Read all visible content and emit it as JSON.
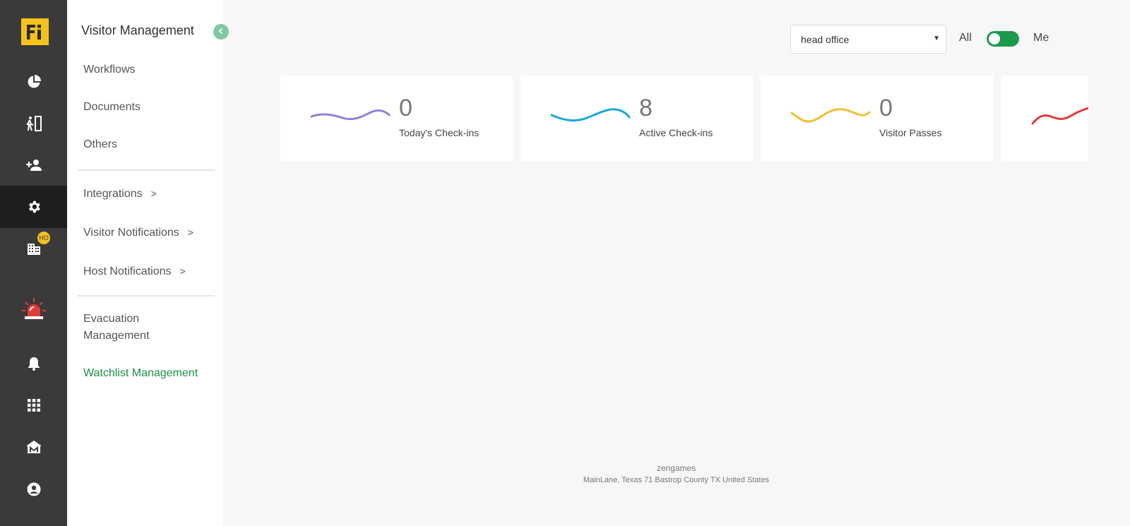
{
  "brand": {
    "logo_text": "Fi",
    "accent_color": "#f4c21c"
  },
  "rail": {
    "items": [
      {
        "icon": "dashboard-pie-icon"
      },
      {
        "icon": "exit-door-icon"
      },
      {
        "icon": "add-person-icon"
      },
      {
        "icon": "gear-icon",
        "active": true
      },
      {
        "icon": "building-icon",
        "badge": "HO"
      },
      {
        "icon": "emergency-siren-icon"
      },
      {
        "icon": "bell-icon"
      },
      {
        "icon": "apps-grid-icon"
      },
      {
        "icon": "marketplace-icon"
      },
      {
        "icon": "account-icon"
      }
    ]
  },
  "menu": {
    "title": "Visitor Management",
    "items": {
      "workflows": "Workflows",
      "documents": "Documents",
      "others": "Others",
      "integrations": "Integrations",
      "visitor_notifications": "Visitor Notifications",
      "host_notifications": "Host Notifications",
      "evacuation_line1": "Evacuation",
      "evacuation_line2": "Management",
      "watchlist": "Watchlist Management"
    },
    "chevron": ">"
  },
  "filters": {
    "location": "head office",
    "scope_all": "All",
    "scope_me": "Me",
    "toggle_color": "#1a9a4c"
  },
  "stats": [
    {
      "value": "0",
      "label": "Today's Check-ins",
      "color": "#8b84d7"
    },
    {
      "value": "8",
      "label": "Active Check-ins",
      "color": "#1ea6d8"
    },
    {
      "value": "0",
      "label": "Visitor Passes",
      "color": "#f0c030"
    },
    {
      "color": "#e23b3b"
    }
  ],
  "footer": {
    "company": "zengames",
    "address": "MainLane, Texas 71 Bastrop County TX United States"
  },
  "highlight_color": "#1a8f4a"
}
